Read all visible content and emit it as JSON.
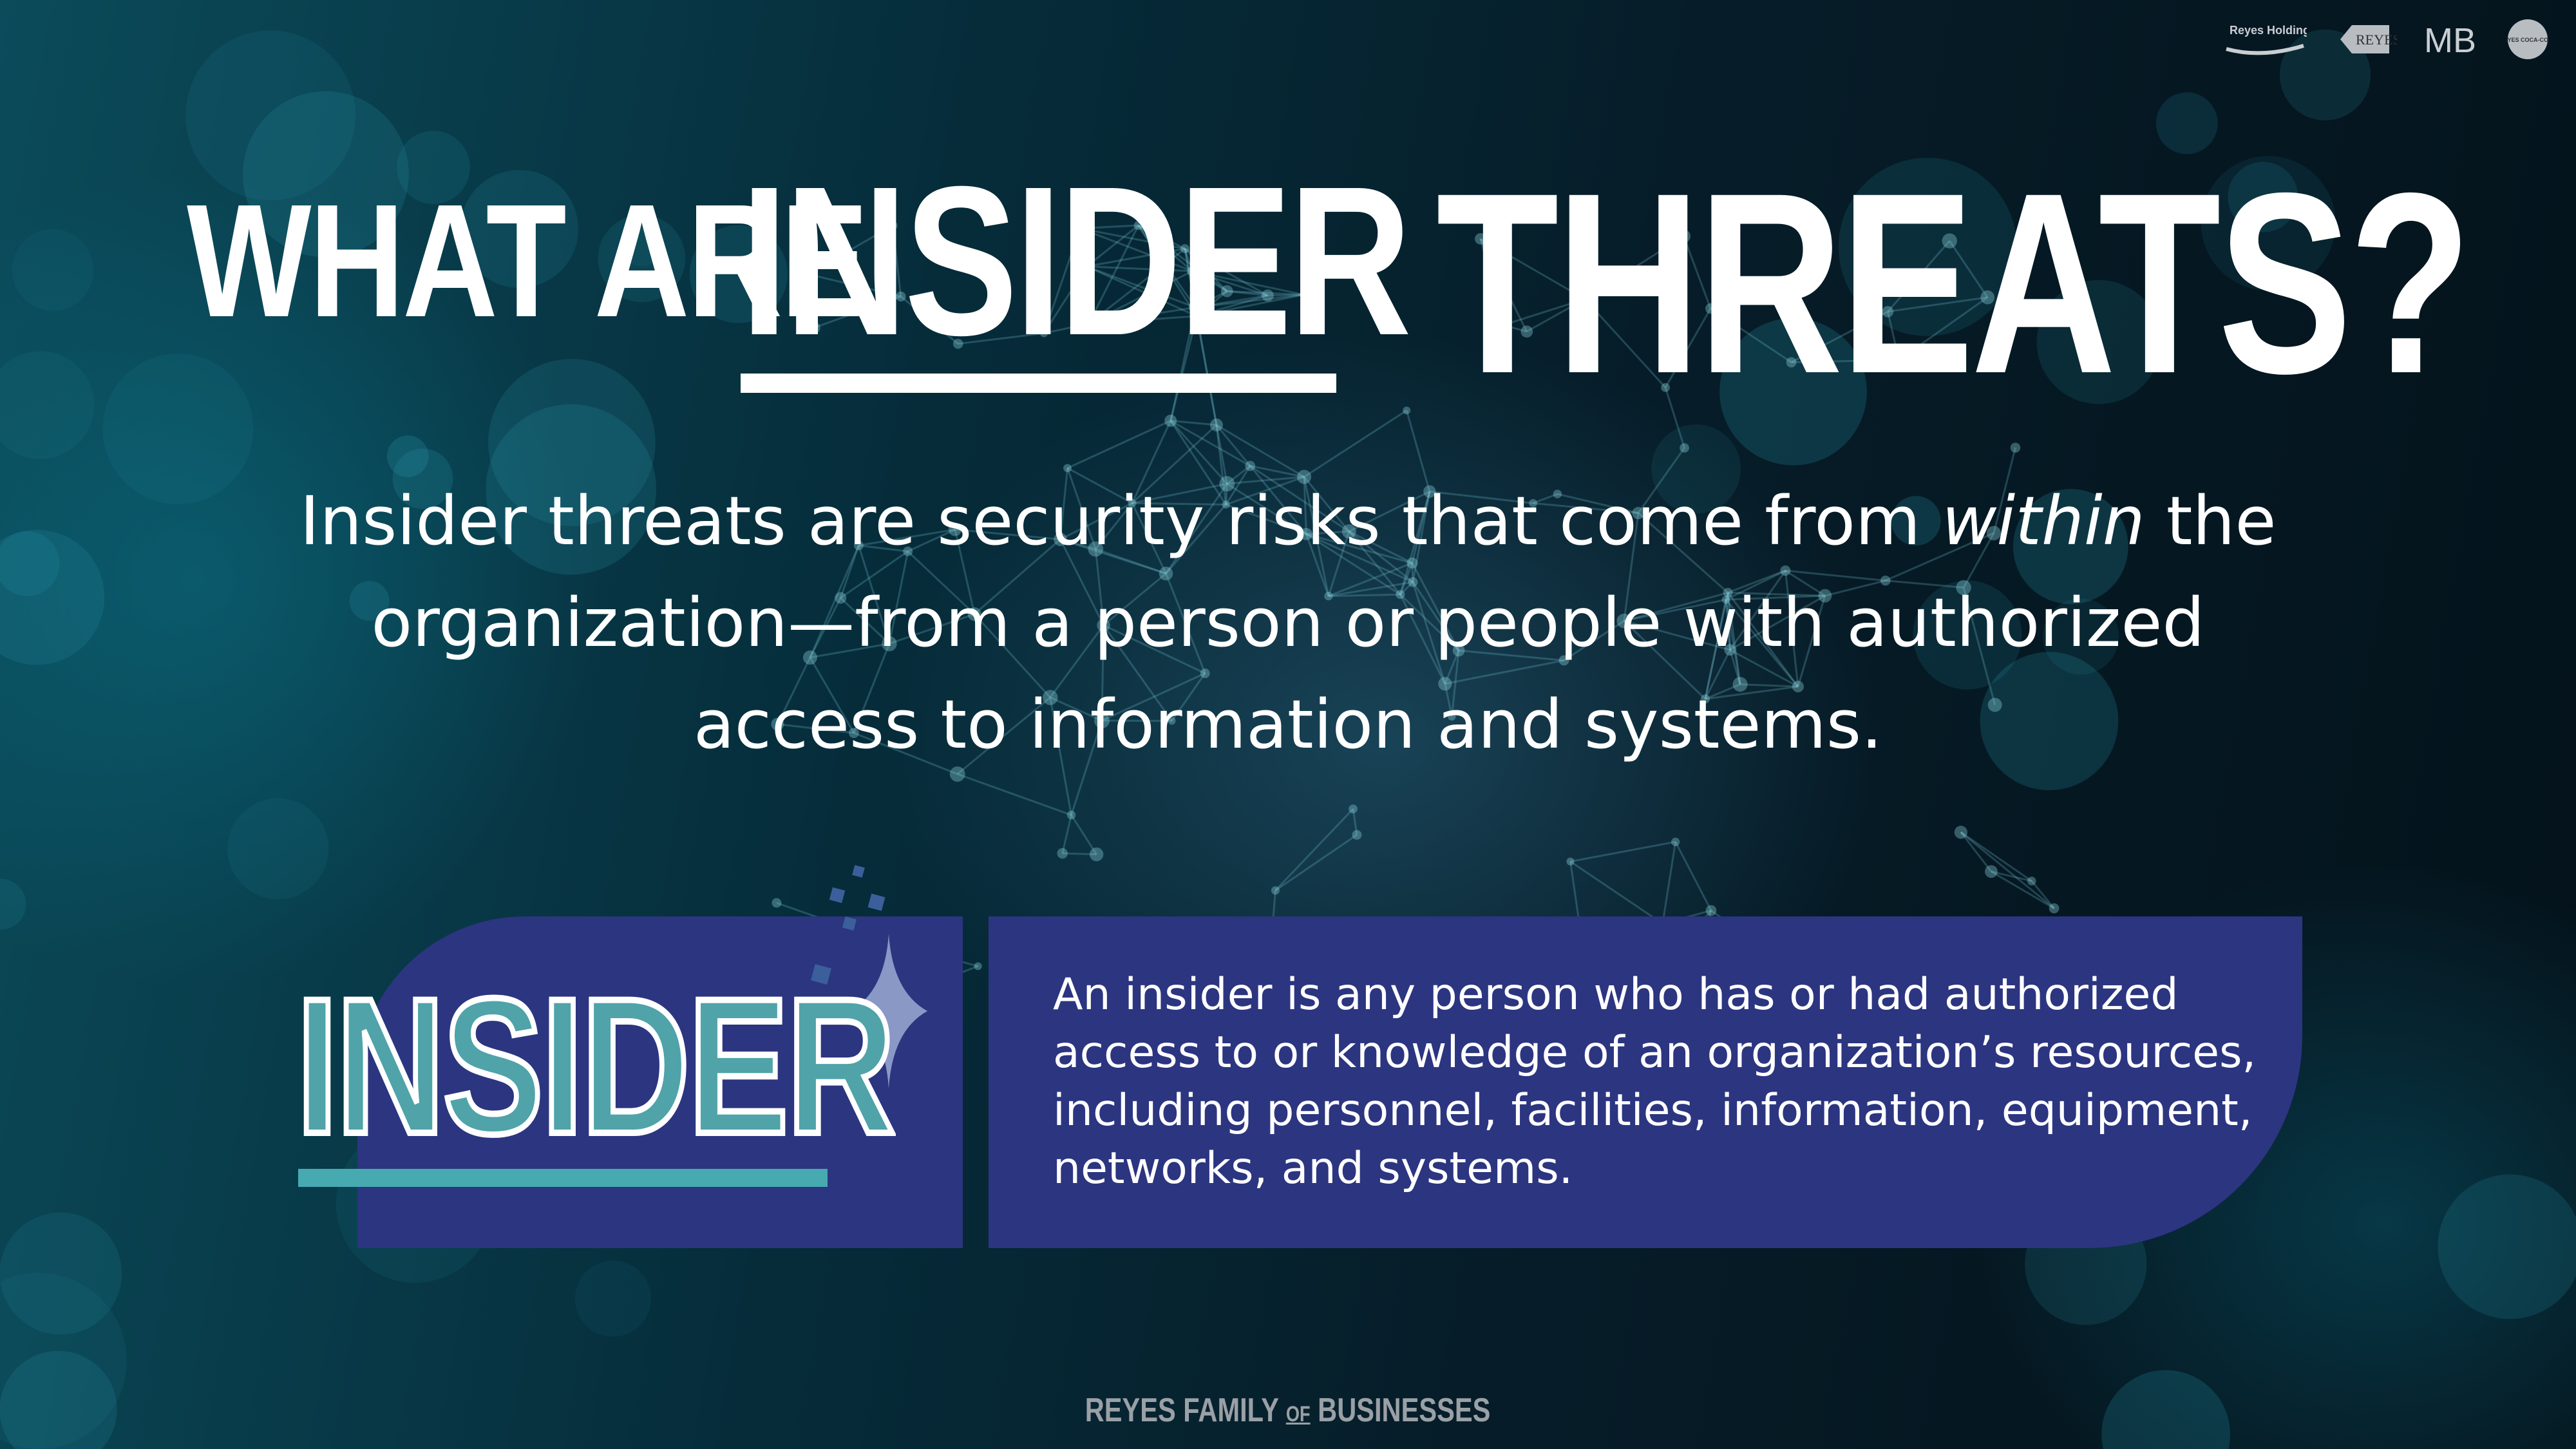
{
  "logos": {
    "reyes_holdings": "Reyes Holdings",
    "reyes": "REYES",
    "mb": "MB",
    "coca_cola": "REYES COCA-COLA"
  },
  "title": {
    "part1": "WHAT ARE",
    "part2": "INSIDER",
    "part3": "THREATS?"
  },
  "intro": {
    "before_em": "Insider threats are security risks that come from ",
    "em": "within",
    "after_em": " the organization—from a person or people with authorized access to information and systems."
  },
  "insider_card": {
    "word": "INSIDER",
    "definition": "An insider is any person who has or had authorized access to or knowledge of an organization’s resources, including personnel, facilities, information, equipment, networks, and systems."
  },
  "footer": {
    "left": "REYES FAMILY ",
    "of": "OF",
    "right": " BUSINESSES"
  },
  "colors": {
    "card": "#2c3580",
    "teal": "#4fa3a9",
    "text": "#ffffff",
    "footer": "#9aa0a6"
  }
}
